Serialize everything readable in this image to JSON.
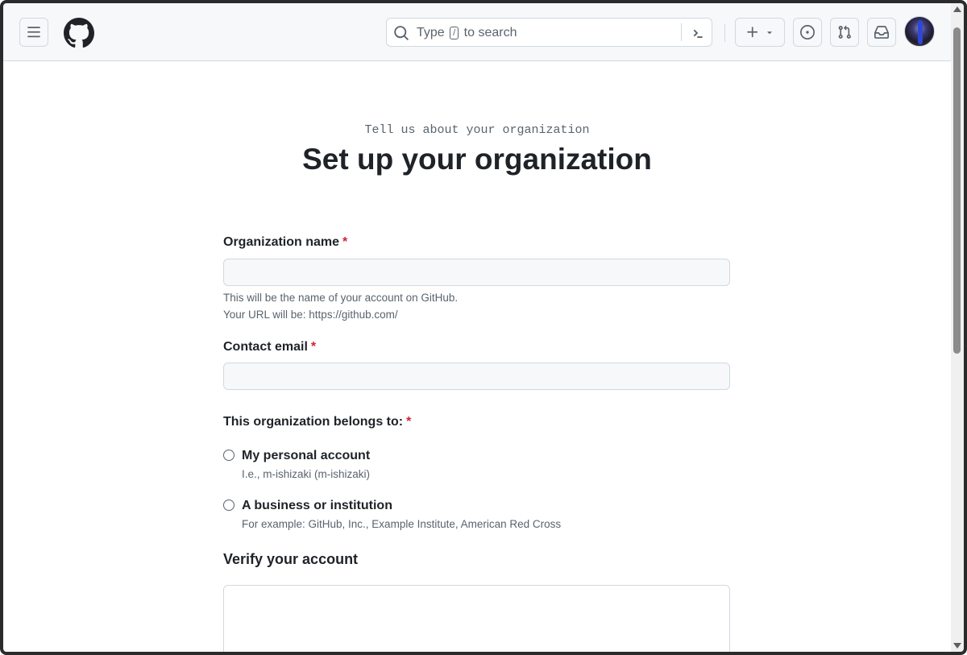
{
  "header": {
    "search": {
      "placeholder_before": "Type",
      "shortcut_key": "/",
      "placeholder_after": "to search"
    },
    "icons": {
      "menu": "hamburger-icon",
      "logo": "github-logo-icon",
      "search": "search-icon",
      "command_palette": "terminal-icon",
      "create": "plus-icon",
      "create_dropdown": "triangle-down-icon",
      "issues": "issue-opened-icon",
      "pull_requests": "git-pull-request-icon",
      "inbox": "inbox-icon"
    }
  },
  "page": {
    "subtitle": "Tell us about your organization",
    "title": "Set up your organization"
  },
  "form": {
    "org_name": {
      "label": "Organization name",
      "required_marker": "*",
      "value": "",
      "help_line1": "This will be the name of your account on GitHub.",
      "help_line2": "Your URL will be: https://github.com/"
    },
    "contact_email": {
      "label": "Contact email",
      "required_marker": "*",
      "value": ""
    },
    "belongs_to": {
      "label": "This organization belongs to:",
      "required_marker": "*",
      "options": [
        {
          "label": "My personal account",
          "note": "I.e., m-ishizaki (m-ishizaki)",
          "checked": false
        },
        {
          "label": "A business or institution",
          "note": "For example: GitHub, Inc., Example Institute, American Red Cross",
          "checked": false
        }
      ]
    },
    "verify": {
      "title": "Verify your account"
    }
  },
  "colors": {
    "required": "#d1242f",
    "header_bg": "#f6f8fa",
    "border": "#d1d9e0",
    "muted_text": "#59636e"
  }
}
